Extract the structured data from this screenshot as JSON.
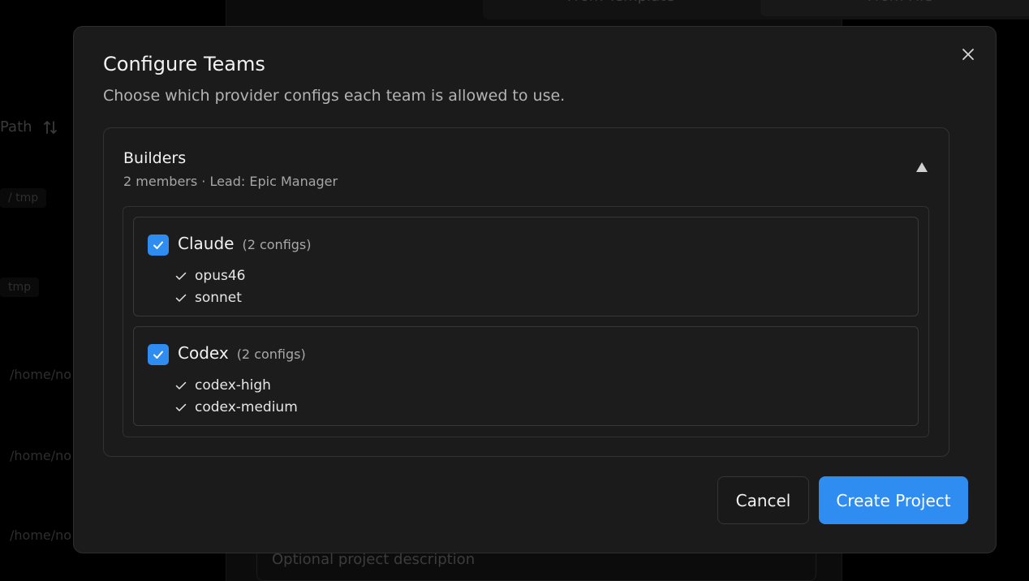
{
  "background": {
    "tabs": [
      "From Template",
      "From File"
    ],
    "path_header": "Path",
    "sort_icon": "sort-arrows-icon",
    "chips": [
      "/ tmp",
      "tmp"
    ],
    "paths": [
      "/home/no",
      "/home/no",
      "/home/no"
    ],
    "description_placeholder": "Optional project description"
  },
  "modal": {
    "title": "Configure Teams",
    "subtitle": "Choose which provider configs each team is allowed to use.",
    "close_icon": "close-icon",
    "team": {
      "name": "Builders",
      "meta": "2 members · Lead: Epic Manager",
      "toggle_icon": "triangle-up-icon",
      "providers": [
        {
          "name": "Claude",
          "count": "(2 configs)",
          "checked": true,
          "configs": [
            "opus46",
            "sonnet"
          ]
        },
        {
          "name": "Codex",
          "count": "(2 configs)",
          "checked": true,
          "configs": [
            "codex-high",
            "codex-medium"
          ]
        }
      ]
    },
    "buttons": {
      "cancel": "Cancel",
      "create": "Create Project"
    }
  },
  "colors": {
    "accent": "#2f8cf0",
    "modal_bg": "#1b1b1b",
    "page_bg": "#000000"
  }
}
